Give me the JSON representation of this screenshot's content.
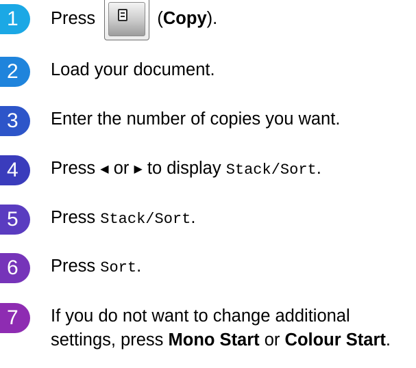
{
  "steps": [
    {
      "number": "1",
      "press": "Press",
      "button_label": "Copy",
      "open_paren": "(",
      "close_paren": ")."
    },
    {
      "number": "2",
      "text": "Load your document."
    },
    {
      "number": "3",
      "text": "Enter the number of copies you want."
    },
    {
      "number": "4",
      "press": "Press",
      "left_arrow": "◀",
      "or": "or",
      "right_arrow": "▶",
      "to_display": "to display",
      "option": "Stack/Sort",
      "period": "."
    },
    {
      "number": "5",
      "press": "Press",
      "option": "Stack/Sort",
      "period": "."
    },
    {
      "number": "6",
      "press": "Press",
      "option": "Sort",
      "period": "."
    },
    {
      "number": "7",
      "text_a": "If you do not want to change additional settings, press",
      "mono_start": "Mono Start",
      "or": "or",
      "colour_start": "Colour Start",
      "period": "."
    }
  ],
  "icons": {
    "copy_key": "copy-key-icon",
    "document": "document-icon"
  },
  "colors": {
    "step1": "#1ba8e5",
    "step2": "#1f84dc",
    "step3": "#2d55c9",
    "step4": "#3a3cbc",
    "step5": "#5a3cc0",
    "step6": "#7634b9",
    "step7": "#8e2cb2"
  }
}
